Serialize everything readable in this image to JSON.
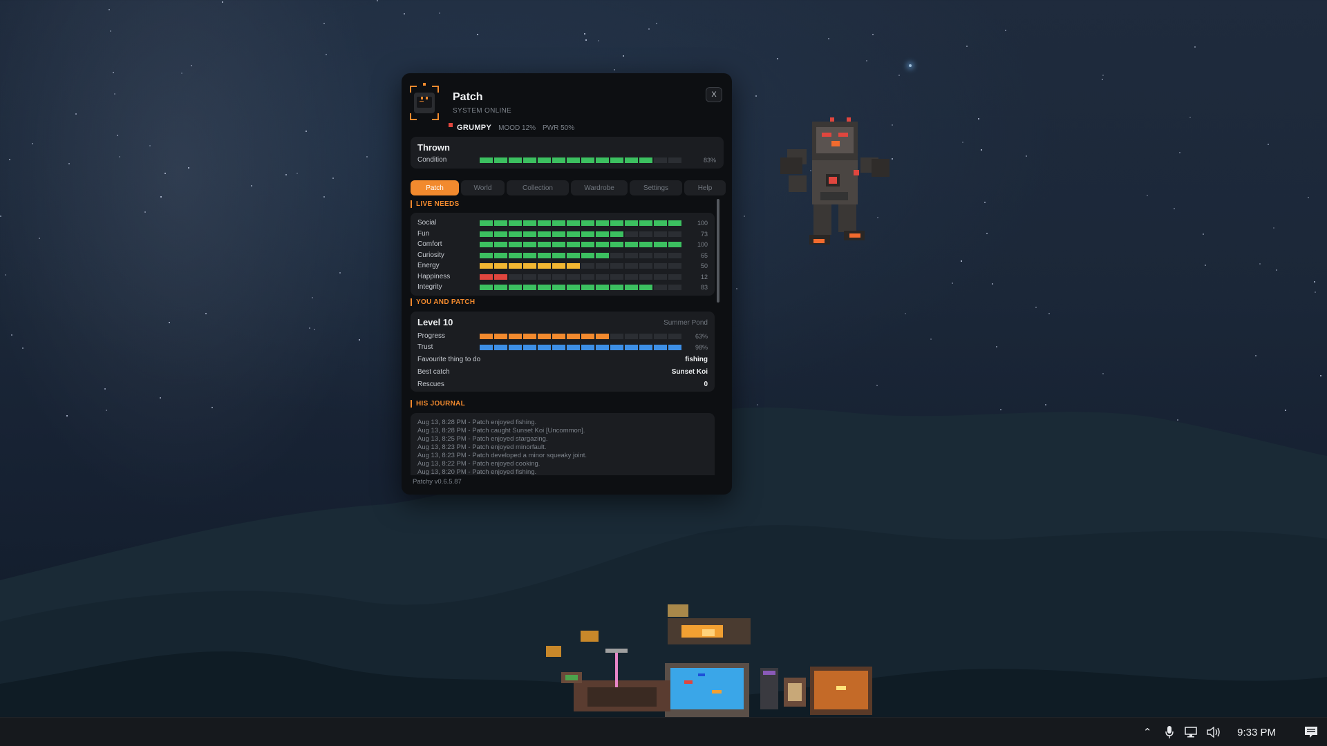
{
  "window": {
    "name": "Patch",
    "status": "SYSTEM ONLINE",
    "mood": "GRUMPY",
    "mood_stat": "MOOD 12%",
    "power_stat": "PWR 50%",
    "close_label": "X"
  },
  "state_card": {
    "title": "Thrown",
    "condition_label": "Condition",
    "condition_value": "83%",
    "condition_fraction": 0.83,
    "bar_color": "#3cc060"
  },
  "tabs": [
    "Patch",
    "World",
    "Collection",
    "Wardrobe",
    "Settings",
    "Help"
  ],
  "active_tab": "Patch",
  "live_needs": {
    "heading": "LIVE NEEDS",
    "items": [
      {
        "label": "Social",
        "value": "100",
        "fraction": 1.0,
        "color": "#3cc060"
      },
      {
        "label": "Fun",
        "value": "73",
        "fraction": 0.73,
        "color": "#3cc060"
      },
      {
        "label": "Comfort",
        "value": "100",
        "fraction": 1.0,
        "color": "#3cc060"
      },
      {
        "label": "Curiosity",
        "value": "65",
        "fraction": 0.65,
        "color": "#3cc060"
      },
      {
        "label": "Energy",
        "value": "50",
        "fraction": 0.5,
        "color": "#f2b632"
      },
      {
        "label": "Happiness",
        "value": "12",
        "fraction": 0.12,
        "color": "#e0463e"
      },
      {
        "label": "Integrity",
        "value": "83",
        "fraction": 0.86,
        "color": "#3cc060"
      }
    ]
  },
  "you_and_patch": {
    "heading": "YOU AND PATCH",
    "level": "Level 10",
    "place": "Summer Pond",
    "progress_label": "Progress",
    "progress_value": "63%",
    "progress_fraction": 0.63,
    "progress_color": "#f28a2e",
    "trust_label": "Trust",
    "trust_value": "98%",
    "trust_fraction": 1.0,
    "trust_color": "#3d8fe6",
    "favourite_label": "Favourite thing to do",
    "favourite_value": "fishing",
    "best_catch_label": "Best catch",
    "best_catch_value": "Sunset Koi",
    "rescues_label": "Rescues",
    "rescues_value": "0"
  },
  "journal": {
    "heading": "HIS JOURNAL",
    "entries": [
      "Aug 13, 8:28 PM - Patch enjoyed fishing.",
      "Aug 13, 8:28 PM - Patch caught Sunset Koi [Uncommon].",
      "Aug 13, 8:25 PM - Patch enjoyed stargazing.",
      "Aug 13, 8:23 PM - Patch enjoyed minorfault.",
      "Aug 13, 8:23 PM - Patch developed a minor squeaky joint.",
      "Aug 13, 8:22 PM - Patch enjoyed cooking.",
      "Aug 13, 8:20 PM - Patch enjoyed fishing."
    ]
  },
  "version": "Patchy v0.6.5.87",
  "taskbar": {
    "clock": "9:33 PM",
    "icons": [
      "chevron-up-icon",
      "microphone-icon",
      "network-icon",
      "volume-icon",
      "notification-icon"
    ]
  }
}
